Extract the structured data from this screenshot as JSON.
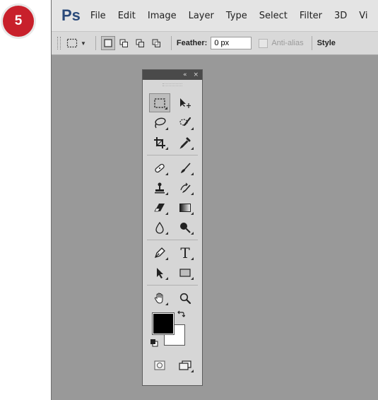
{
  "step": {
    "number": "5",
    "color": "#c8202b"
  },
  "app": {
    "logo": "Ps",
    "menu": [
      "File",
      "Edit",
      "Image",
      "Layer",
      "Type",
      "Select",
      "Filter",
      "3D",
      "Vi"
    ]
  },
  "options_bar": {
    "tool_icon": "rectangular-marquee-icon",
    "selection_modes": [
      "new-selection",
      "add-to-selection",
      "subtract-from-selection",
      "intersect-with-selection"
    ],
    "active_mode": "new-selection",
    "feather_label": "Feather:",
    "feather_value": "0 px",
    "anti_alias_label": "Anti-alias",
    "anti_alias_checked": false,
    "style_label": "Style"
  },
  "toolbox": {
    "header_collapse": "«",
    "header_close": "×",
    "rows": [
      [
        "rectangular-marquee",
        "move"
      ],
      [
        "lasso",
        "quick-selection"
      ],
      [
        "crop",
        "eyedropper"
      ],
      [
        "spot-healing-brush",
        "brush"
      ],
      [
        "clone-stamp",
        "history-brush"
      ],
      [
        "eraser",
        "gradient"
      ],
      [
        "blur",
        "dodge"
      ],
      [
        "pen",
        "type"
      ],
      [
        "path-selection",
        "rectangle"
      ],
      [
        "hand",
        "zoom"
      ]
    ],
    "type_glyph": "T",
    "active_tool": "rectangular-marquee",
    "foreground_color": "#000000",
    "background_color": "#ffffff",
    "bottom_tools": [
      "quick-mask",
      "screen-mode"
    ]
  }
}
